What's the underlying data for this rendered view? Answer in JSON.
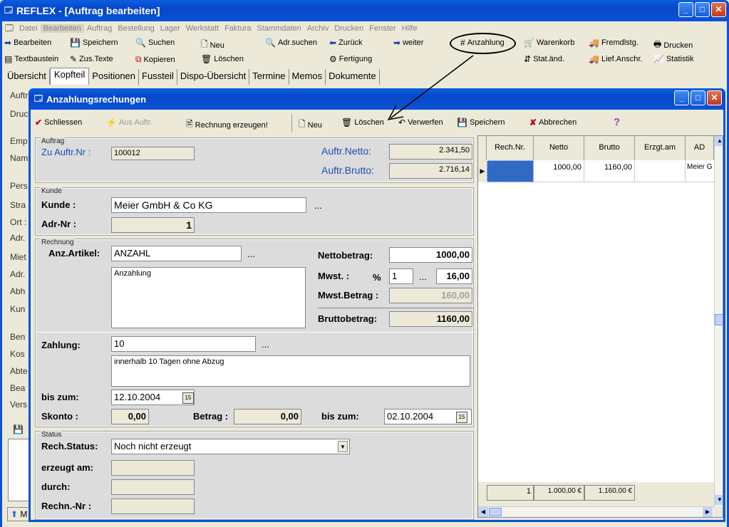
{
  "main_window": {
    "title": "REFLEX - [Auftrag bearbeiten]"
  },
  "menu": [
    "Datei",
    "Bearbeiten",
    "Auftrag",
    "Bestellung",
    "Lager",
    "Werkstatt",
    "Faktura",
    "Stammdaten",
    "Archiv",
    "Drucken",
    "Fenster",
    "Hilfe"
  ],
  "toolbar1": {
    "bearbeiten": "Bearbeiten",
    "speichern": "Speichern",
    "suchen": "Suchen",
    "neu": "Neu",
    "adrsuchen": "Adr.suchen",
    "zurueck": "Zurück",
    "weiter": "weiter",
    "anzahlung": "Anzahlung",
    "warenkorb": "Warenkorb",
    "fremdlstg": "Fremdlstg.",
    "drucken": "Drucken"
  },
  "toolbar2": {
    "textbaustein": "Textbaustein",
    "zustexte": "Zus.Texte",
    "kopieren": "Kopieren",
    "loeschen": "Löschen",
    "fertigung": "Fertigung",
    "statand": "Stat.änd.",
    "liefanschr": "Lief.Anschr.",
    "statistik": "Statistik"
  },
  "tabs": [
    "Übersicht",
    "Kopfteil",
    "Positionen",
    "Fussteil",
    "Dispo-Übersicht",
    "Termine",
    "Memos",
    "Dokumente"
  ],
  "bg_labels": [
    "Auftr",
    "Druc",
    "Emp",
    "Nam",
    "Pers",
    "Stra",
    "Ort :",
    "Adr.",
    "Miet",
    "Adr.",
    "Abh",
    "Kun",
    "Ben",
    "Kos",
    "Abte",
    "Bea",
    "Vers"
  ],
  "bg_bottom_btn": "M",
  "dialog": {
    "title": "Anzahlungsrechungen",
    "toolbar": {
      "schliessen": "Schliessen",
      "ausauftr": "Aus Auftr.",
      "rechnung": "Rechnung erzeugen!",
      "neu": "Neu",
      "loeschen": "Löschen",
      "verwerfen": "Verwerfen",
      "speichern": "Speichern",
      "abbrechen": "Abbrechen",
      "help": "?"
    },
    "auftrag": {
      "caption": "Auftrag",
      "zu_label": "Zu Auftr.Nr :",
      "zu_value": "100012",
      "netto_label": "Auftr.Netto:",
      "netto_value": "2.341,50",
      "brutto_label": "Auftr.Brutto:",
      "brutto_value": "2.716,14"
    },
    "kunde": {
      "caption": "Kunde",
      "kunde_label": "Kunde :",
      "kunde_value": "Meier GmbH & Co KG",
      "adrnr_label": "Adr-Nr :",
      "adrnr_value": "1",
      "dots": "..."
    },
    "rechnung": {
      "caption": "Rechnung",
      "artikel_label": "Anz.Artikel:",
      "artikel_value": "ANZAHL",
      "text_value": "Anzahlung",
      "netto_label": "Nettobetrag:",
      "netto_value": "1000,00",
      "mwst_label": "Mwst. :",
      "pct": "%",
      "mwst_code": "1",
      "mwst_pct": "16,00",
      "mwstbetrag_label": "Mwst.Betrag :",
      "mwstbetrag_value": "160,00",
      "brutto_label": "Bruttobetrag:",
      "brutto_value": "1160,00",
      "dots": "..."
    },
    "zahlung": {
      "label": "Zahlung:",
      "value": "10",
      "text": "innerhalb 10 Tagen ohne Abzug",
      "biszum_label": "bis zum:",
      "biszum_value": "12.10.2004",
      "skonto_label": "Skonto :",
      "skonto_value": "0,00",
      "betrag_label": "Betrag :",
      "betrag_value": "0,00",
      "biszum2_label": "bis zum:",
      "biszum2_value": "02.10.2004",
      "dots": "...",
      "cal": "15"
    },
    "status": {
      "caption": "Status",
      "status_label": "Rech.Status:",
      "status_value": "Noch nicht erzeugt",
      "erzeugt_label": "erzeugt am:",
      "durch_label": "durch:",
      "rechnr_label": "Rechn.-Nr :"
    },
    "grid": {
      "headers": [
        "Rech.Nr.",
        "Netto",
        "Brutto",
        "Erzgt.am",
        "AD"
      ],
      "row": [
        "",
        "1000,00",
        "1160,00",
        "",
        "Meier G"
      ],
      "footer": [
        "1",
        "1.000,00 €",
        "1.160,00 €"
      ]
    }
  }
}
